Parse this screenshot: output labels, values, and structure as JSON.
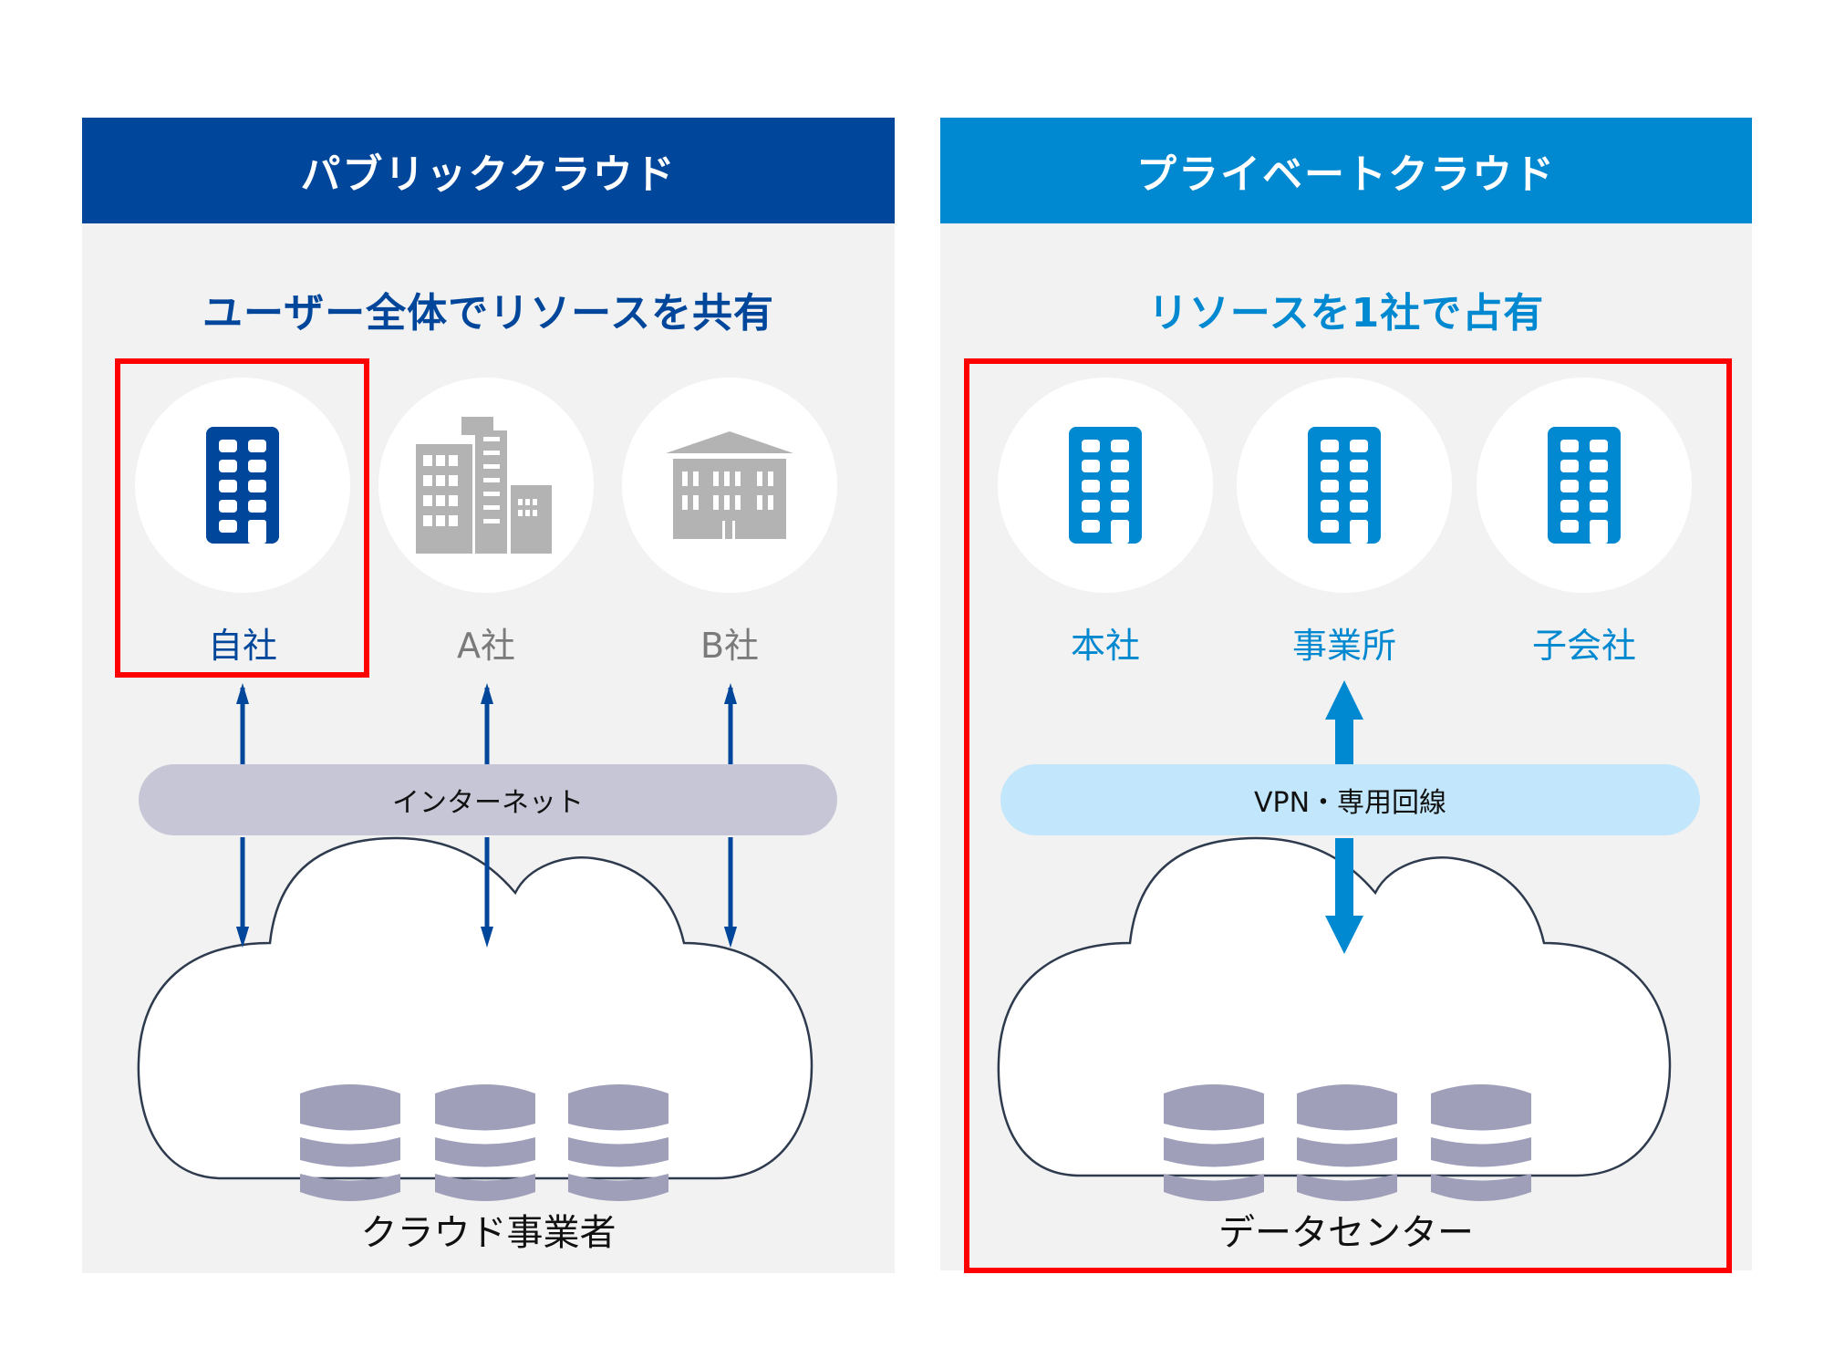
{
  "colors": {
    "public_primary": "#00469b",
    "private_primary": "#0088d0",
    "building_gray": "#b3b3b3",
    "internet_pill": "#c6c6d7",
    "vpn_pill": "#c2e6fb",
    "database": "#9f9fba",
    "highlight_red": "#ff0000",
    "panel_bg": "#f2f2f2"
  },
  "public_cloud": {
    "title": "パブリッククラウド",
    "subtitle": "ユーザー全体でリソースを共有",
    "sites": [
      {
        "label": "自社",
        "icon": "office-building-icon",
        "highlighted": true
      },
      {
        "label": "A社",
        "icon": "city-buildings-icon",
        "highlighted": false
      },
      {
        "label": "B社",
        "icon": "columned-building-icon",
        "highlighted": false
      }
    ],
    "network_label": "インターネット",
    "provider_label": "クラウド事業者",
    "database_count": 3
  },
  "private_cloud": {
    "title": "プライベートクラウド",
    "subtitle": "リソースを1社で占有",
    "sites": [
      {
        "label": "本社",
        "icon": "office-building-icon"
      },
      {
        "label": "事業所",
        "icon": "office-building-icon"
      },
      {
        "label": "子会社",
        "icon": "office-building-icon"
      }
    ],
    "network_label": "VPN・専用回線",
    "provider_label": "データセンター",
    "database_count": 3
  }
}
